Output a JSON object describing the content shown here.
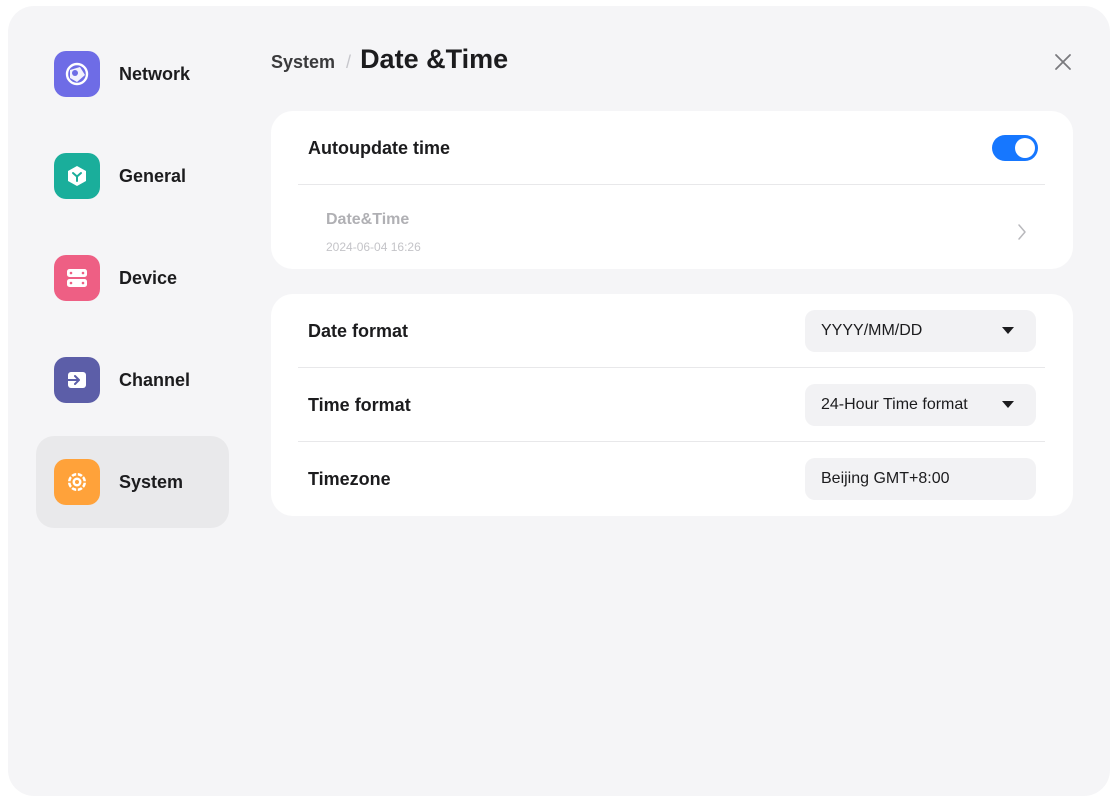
{
  "sidebar": {
    "items": [
      {
        "label": "Network",
        "icon": "network-icon",
        "color": "#6e6ce6"
      },
      {
        "label": "General",
        "icon": "general-icon",
        "color": "#1aae9b"
      },
      {
        "label": "Device",
        "icon": "device-icon",
        "color": "#ee5f84"
      },
      {
        "label": "Channel",
        "icon": "channel-icon",
        "color": "#5c5ea8"
      },
      {
        "label": "System",
        "icon": "system-icon",
        "color": "#ffa23a",
        "active": true
      }
    ]
  },
  "header": {
    "parent": "System",
    "separator": "/",
    "title": "Date &Time"
  },
  "auto_update": {
    "label": "Autoupdate time",
    "enabled": true,
    "accent": "#1677ff"
  },
  "date_time": {
    "label": "Date&Time",
    "value": "2024-06-04 16:26"
  },
  "formats": {
    "date_format": {
      "label": "Date format",
      "value": "YYYY/MM/DD"
    },
    "time_format": {
      "label": "Time format",
      "value": "24-Hour Time format"
    },
    "timezone": {
      "label": "Timezone",
      "value": "Beijing GMT+8:00"
    }
  }
}
